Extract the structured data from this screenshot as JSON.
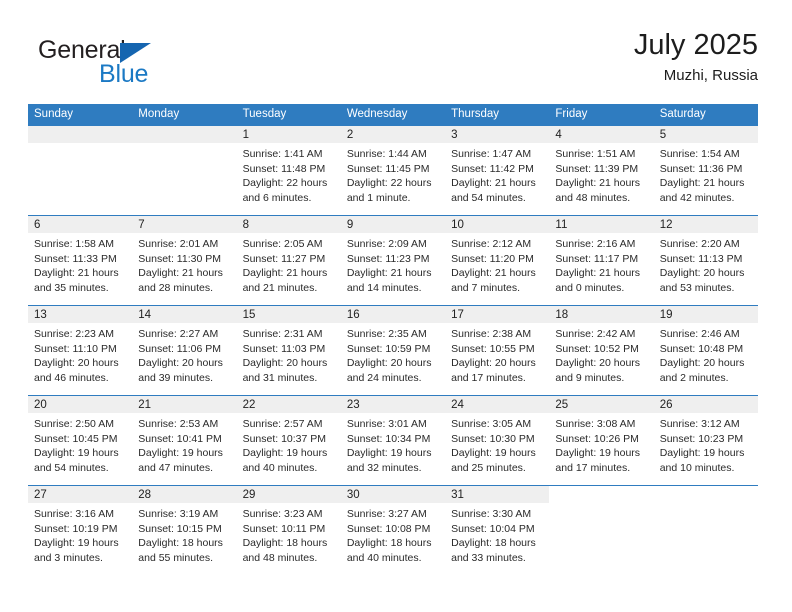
{
  "brand": {
    "name_top": "General",
    "name_bottom": "Blue",
    "triangle_color": "#1565b0",
    "blue_color": "#1b79c4",
    "top_color": "#231f20"
  },
  "header": {
    "title": "July 2025",
    "subtitle": "Muzhi, Russia"
  },
  "theme": {
    "header_blue": "#2f7cc0",
    "daynum_band": "#efefef",
    "row_divider": "#2f7cc0",
    "text": "#2a2a2a"
  },
  "calendar": {
    "weekday_headers": [
      "Sunday",
      "Monday",
      "Tuesday",
      "Wednesday",
      "Thursday",
      "Friday",
      "Saturday"
    ],
    "weeks": [
      [
        {
          "day": "",
          "empty": true
        },
        {
          "day": "",
          "empty": true
        },
        {
          "day": "1",
          "sunrise": "Sunrise: 1:41 AM",
          "sunset": "Sunset: 11:48 PM",
          "daylight1": "Daylight: 22 hours",
          "daylight2": "and 6 minutes."
        },
        {
          "day": "2",
          "sunrise": "Sunrise: 1:44 AM",
          "sunset": "Sunset: 11:45 PM",
          "daylight1": "Daylight: 22 hours",
          "daylight2": "and 1 minute."
        },
        {
          "day": "3",
          "sunrise": "Sunrise: 1:47 AM",
          "sunset": "Sunset: 11:42 PM",
          "daylight1": "Daylight: 21 hours",
          "daylight2": "and 54 minutes."
        },
        {
          "day": "4",
          "sunrise": "Sunrise: 1:51 AM",
          "sunset": "Sunset: 11:39 PM",
          "daylight1": "Daylight: 21 hours",
          "daylight2": "and 48 minutes."
        },
        {
          "day": "5",
          "sunrise": "Sunrise: 1:54 AM",
          "sunset": "Sunset: 11:36 PM",
          "daylight1": "Daylight: 21 hours",
          "daylight2": "and 42 minutes."
        }
      ],
      [
        {
          "day": "6",
          "sunrise": "Sunrise: 1:58 AM",
          "sunset": "Sunset: 11:33 PM",
          "daylight1": "Daylight: 21 hours",
          "daylight2": "and 35 minutes."
        },
        {
          "day": "7",
          "sunrise": "Sunrise: 2:01 AM",
          "sunset": "Sunset: 11:30 PM",
          "daylight1": "Daylight: 21 hours",
          "daylight2": "and 28 minutes."
        },
        {
          "day": "8",
          "sunrise": "Sunrise: 2:05 AM",
          "sunset": "Sunset: 11:27 PM",
          "daylight1": "Daylight: 21 hours",
          "daylight2": "and 21 minutes."
        },
        {
          "day": "9",
          "sunrise": "Sunrise: 2:09 AM",
          "sunset": "Sunset: 11:23 PM",
          "daylight1": "Daylight: 21 hours",
          "daylight2": "and 14 minutes."
        },
        {
          "day": "10",
          "sunrise": "Sunrise: 2:12 AM",
          "sunset": "Sunset: 11:20 PM",
          "daylight1": "Daylight: 21 hours",
          "daylight2": "and 7 minutes."
        },
        {
          "day": "11",
          "sunrise": "Sunrise: 2:16 AM",
          "sunset": "Sunset: 11:17 PM",
          "daylight1": "Daylight: 21 hours",
          "daylight2": "and 0 minutes."
        },
        {
          "day": "12",
          "sunrise": "Sunrise: 2:20 AM",
          "sunset": "Sunset: 11:13 PM",
          "daylight1": "Daylight: 20 hours",
          "daylight2": "and 53 minutes."
        }
      ],
      [
        {
          "day": "13",
          "sunrise": "Sunrise: 2:23 AM",
          "sunset": "Sunset: 11:10 PM",
          "daylight1": "Daylight: 20 hours",
          "daylight2": "and 46 minutes."
        },
        {
          "day": "14",
          "sunrise": "Sunrise: 2:27 AM",
          "sunset": "Sunset: 11:06 PM",
          "daylight1": "Daylight: 20 hours",
          "daylight2": "and 39 minutes."
        },
        {
          "day": "15",
          "sunrise": "Sunrise: 2:31 AM",
          "sunset": "Sunset: 11:03 PM",
          "daylight1": "Daylight: 20 hours",
          "daylight2": "and 31 minutes."
        },
        {
          "day": "16",
          "sunrise": "Sunrise: 2:35 AM",
          "sunset": "Sunset: 10:59 PM",
          "daylight1": "Daylight: 20 hours",
          "daylight2": "and 24 minutes."
        },
        {
          "day": "17",
          "sunrise": "Sunrise: 2:38 AM",
          "sunset": "Sunset: 10:55 PM",
          "daylight1": "Daylight: 20 hours",
          "daylight2": "and 17 minutes."
        },
        {
          "day": "18",
          "sunrise": "Sunrise: 2:42 AM",
          "sunset": "Sunset: 10:52 PM",
          "daylight1": "Daylight: 20 hours",
          "daylight2": "and 9 minutes."
        },
        {
          "day": "19",
          "sunrise": "Sunrise: 2:46 AM",
          "sunset": "Sunset: 10:48 PM",
          "daylight1": "Daylight: 20 hours",
          "daylight2": "and 2 minutes."
        }
      ],
      [
        {
          "day": "20",
          "sunrise": "Sunrise: 2:50 AM",
          "sunset": "Sunset: 10:45 PM",
          "daylight1": "Daylight: 19 hours",
          "daylight2": "and 54 minutes."
        },
        {
          "day": "21",
          "sunrise": "Sunrise: 2:53 AM",
          "sunset": "Sunset: 10:41 PM",
          "daylight1": "Daylight: 19 hours",
          "daylight2": "and 47 minutes."
        },
        {
          "day": "22",
          "sunrise": "Sunrise: 2:57 AM",
          "sunset": "Sunset: 10:37 PM",
          "daylight1": "Daylight: 19 hours",
          "daylight2": "and 40 minutes."
        },
        {
          "day": "23",
          "sunrise": "Sunrise: 3:01 AM",
          "sunset": "Sunset: 10:34 PM",
          "daylight1": "Daylight: 19 hours",
          "daylight2": "and 32 minutes."
        },
        {
          "day": "24",
          "sunrise": "Sunrise: 3:05 AM",
          "sunset": "Sunset: 10:30 PM",
          "daylight1": "Daylight: 19 hours",
          "daylight2": "and 25 minutes."
        },
        {
          "day": "25",
          "sunrise": "Sunrise: 3:08 AM",
          "sunset": "Sunset: 10:26 PM",
          "daylight1": "Daylight: 19 hours",
          "daylight2": "and 17 minutes."
        },
        {
          "day": "26",
          "sunrise": "Sunrise: 3:12 AM",
          "sunset": "Sunset: 10:23 PM",
          "daylight1": "Daylight: 19 hours",
          "daylight2": "and 10 minutes."
        }
      ],
      [
        {
          "day": "27",
          "sunrise": "Sunrise: 3:16 AM",
          "sunset": "Sunset: 10:19 PM",
          "daylight1": "Daylight: 19 hours",
          "daylight2": "and 3 minutes."
        },
        {
          "day": "28",
          "sunrise": "Sunrise: 3:19 AM",
          "sunset": "Sunset: 10:15 PM",
          "daylight1": "Daylight: 18 hours",
          "daylight2": "and 55 minutes."
        },
        {
          "day": "29",
          "sunrise": "Sunrise: 3:23 AM",
          "sunset": "Sunset: 10:11 PM",
          "daylight1": "Daylight: 18 hours",
          "daylight2": "and 48 minutes."
        },
        {
          "day": "30",
          "sunrise": "Sunrise: 3:27 AM",
          "sunset": "Sunset: 10:08 PM",
          "daylight1": "Daylight: 18 hours",
          "daylight2": "and 40 minutes."
        },
        {
          "day": "31",
          "sunrise": "Sunrise: 3:30 AM",
          "sunset": "Sunset: 10:04 PM",
          "daylight1": "Daylight: 18 hours",
          "daylight2": "and 33 minutes."
        },
        {
          "day": "",
          "empty": true,
          "blank": true
        },
        {
          "day": "",
          "empty": true,
          "blank": true
        }
      ]
    ]
  }
}
